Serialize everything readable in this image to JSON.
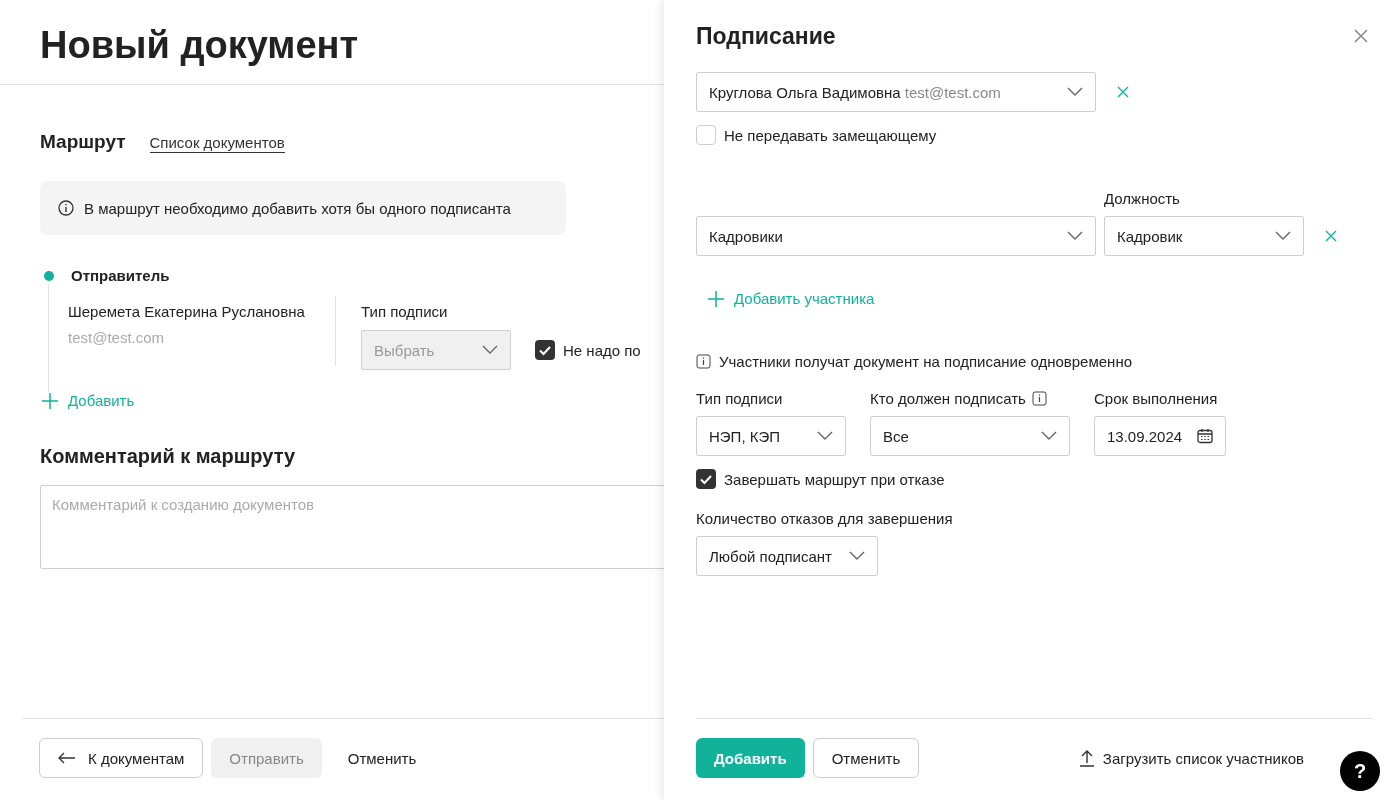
{
  "page": {
    "title": "Новый документ",
    "route_heading": "Маршрут",
    "documents_link": "Список документов",
    "notice": "В маршрут необходимо добавить хотя бы одного подписанта",
    "sender": {
      "label": "Отправитель",
      "name": "Шеремета Екатерина Руслановна",
      "email": "test@test.com",
      "signature_label": "Тип подписи",
      "signature_select": {
        "placeholder": "Выбрать",
        "disabled": true
      },
      "checkbox": {
        "label": "Не надо по",
        "checked": true
      }
    },
    "add_link": "Добавить",
    "comment_heading": "Комментарий к маршруту",
    "comment_field": {
      "placeholder": "Комментарий к созданию документов"
    },
    "footer": {
      "back_button": "К документам",
      "send_button": {
        "label": "Отправить",
        "disabled": true
      },
      "cancel_button": "Отменить"
    }
  },
  "drawer": {
    "title": "Подписание",
    "participants": [
      {
        "kind": "person",
        "value": "Круглова Ольга Вадимовна",
        "email": "test@test.com",
        "checkbox": {
          "label": "Не передавать замещающему",
          "checked": false
        }
      },
      {
        "kind": "group",
        "value": "Кадровики",
        "position_label": "Должность",
        "position": "Кадровик"
      }
    ],
    "add_participant": "Добавить участника",
    "info_note": "Участники получат документ на подписание одновременно",
    "signature_type": {
      "label": "Тип подписи",
      "value": "НЭП, КЭП"
    },
    "who_signs": {
      "label": "Кто должен подписать",
      "value": "Все"
    },
    "deadline": {
      "label": "Срок выполнения",
      "value": "13.09.2024"
    },
    "finish_on_refusal": {
      "label": "Завершать маршрут при отказе",
      "checked": true
    },
    "refusals": {
      "label": "Количество отказов для завершения",
      "value": "Любой подписант"
    },
    "add_button": "Добавить",
    "cancel_button": "Отменить",
    "upload_link": "Загрузить список участников"
  },
  "help_button": "?"
}
